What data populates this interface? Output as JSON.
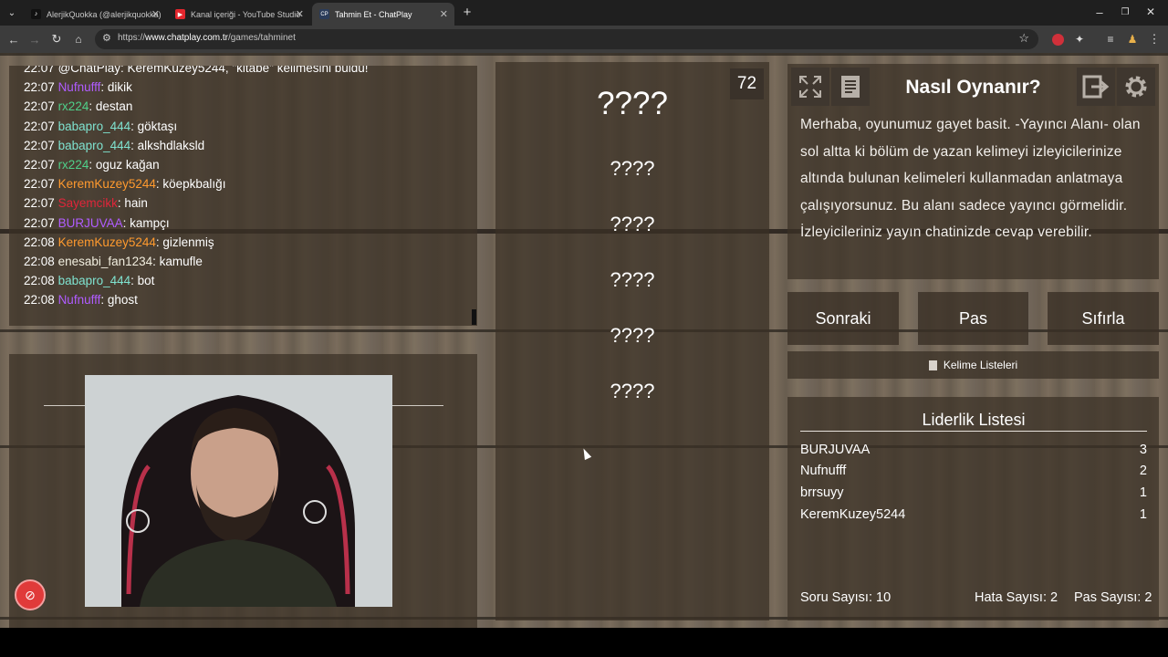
{
  "browser": {
    "tabs": [
      {
        "title": "AlerjikQuokka (@alerjikquokka)",
        "icon": "tiktok-icon"
      },
      {
        "title": "Kanal içeriği - YouTube Studio",
        "icon": "youtube-icon"
      },
      {
        "title": "Tahmin Et - ChatPlay",
        "icon": "chatplay-icon",
        "fav_text": "CP"
      }
    ],
    "url_prefix": "https://",
    "url_host": "www.chatplay.com.tr",
    "url_path": "/games/tahminet"
  },
  "chat": {
    "messages": [
      {
        "time": "22:07",
        "user": "@ChatPlay",
        "user_color": "#ffffff",
        "text": ": KeremKuzey5244, \"kitabe\" kelimesini buldu!"
      },
      {
        "time": "22:07",
        "user": "Nufnufff",
        "user_color": "#b05cff",
        "text": ": dikik"
      },
      {
        "time": "22:07",
        "user": "rx224",
        "user_color": "#4fd08a",
        "text": ": destan"
      },
      {
        "time": "22:07",
        "user": "babapro_444",
        "user_color": "#7fe3d0",
        "text": ": göktaşı"
      },
      {
        "time": "22:07",
        "user": "babapro_444",
        "user_color": "#7fe3d0",
        "text": ": alkshdlaksld"
      },
      {
        "time": "22:07",
        "user": "rx224",
        "user_color": "#4fd08a",
        "text": ": oguz kağan"
      },
      {
        "time": "22:07",
        "user": "KeremKuzey5244",
        "user_color": "#ff9a2e",
        "text": ": köepkbalığı"
      },
      {
        "time": "22:07",
        "user": "Sayemcikk",
        "user_color": "#e0253a",
        "text": ": hain"
      },
      {
        "time": "22:07",
        "user": "BURJUVAA",
        "user_color": "#b05cff",
        "text": ": kampçı"
      },
      {
        "time": "22:08",
        "user": "KeremKuzey5244",
        "user_color": "#ff9a2e",
        "text": ": gizlenmiş"
      },
      {
        "time": "22:08",
        "user": "enesabi_fan1234",
        "user_color": "#f2efe0",
        "text": ": kamufle"
      },
      {
        "time": "22:08",
        "user": "babapro_444",
        "user_color": "#7fe3d0",
        "text": ": bot"
      },
      {
        "time": "22:08",
        "user": "Nufnufff",
        "user_color": "#b05cff",
        "text": ": ghost"
      }
    ]
  },
  "game": {
    "timer": "72",
    "words": [
      "????",
      "????",
      "????",
      "????",
      "????",
      "????"
    ]
  },
  "howto": {
    "title": "Nasıl Oynanır?",
    "text": "Merhaba, oyunumuz gayet basit. -Yayıncı Alanı- olan sol altta ki bölüm de yazan kelimeyi izleyicilerinize altında bulunan kelimeleri kullanmadan anlatmaya çalışıyorsunuz. Bu alanı sadece yayıncı görmelidir. İzleyicileriniz yayın chatinizde cevap verebilir."
  },
  "actions": {
    "next": "Sonraki",
    "pass": "Pas",
    "reset": "Sıfırla",
    "word_lists": "Kelime Listeleri"
  },
  "leaderboard": {
    "title": "Liderlik Listesi",
    "rows": [
      {
        "name": "BURJUVAA",
        "score": "3"
      },
      {
        "name": "Nufnufff",
        "score": "2"
      },
      {
        "name": "brrsuyy",
        "score": "1"
      },
      {
        "name": "KeremKuzey5244",
        "score": "1"
      }
    ],
    "questions": "Soru Sayısı: 10",
    "errors": "Hata Sayısı: 2",
    "passes": "Pas Sayısı: 2"
  }
}
